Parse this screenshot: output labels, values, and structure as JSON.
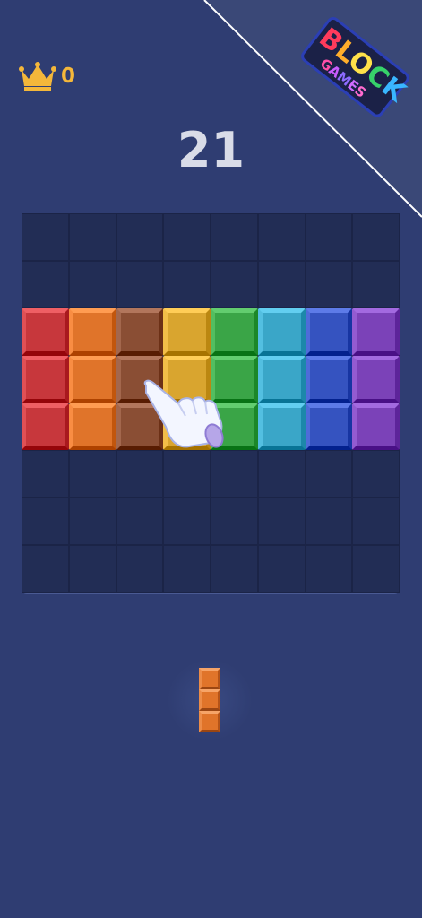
{
  "header": {
    "best_score": "0",
    "current_score": "21"
  },
  "logo": {
    "word1": "BLOCK",
    "word2": "GAMES",
    "letters1": [
      "B",
      "L",
      "O",
      "C",
      "K"
    ],
    "letters2": [
      "G",
      "A",
      "M",
      "E",
      "S"
    ]
  },
  "icons": {
    "crown": "crown-icon",
    "hand": "pointing-hand-icon"
  },
  "colors": {
    "background": "#2f3d72",
    "board": "#1f2a4f",
    "crown": "#f4b73a",
    "red": "#c7373c",
    "orange": "#e0742a",
    "brown": "#8a4e34",
    "yellow": "#d9a52f",
    "green": "#3aa547",
    "cyan": "#3aa6c8",
    "blue": "#3553c0",
    "purple": "#7b42b8"
  },
  "board": {
    "rows": 8,
    "cols": 8,
    "filled_rows": [
      {
        "row": 2,
        "colors": [
          "red",
          "orange",
          "brown",
          "yellow",
          "green",
          "cyan",
          "blue",
          "purple"
        ]
      },
      {
        "row": 3,
        "colors": [
          "red",
          "orange",
          "brown",
          "yellow",
          "green",
          "cyan",
          "blue",
          "purple"
        ]
      },
      {
        "row": 4,
        "colors": [
          "red",
          "orange",
          "brown",
          "yellow",
          "green",
          "cyan",
          "blue",
          "purple"
        ]
      }
    ]
  },
  "next_piece": {
    "color": "orange",
    "shape": "vertical-3",
    "cells": 3
  }
}
